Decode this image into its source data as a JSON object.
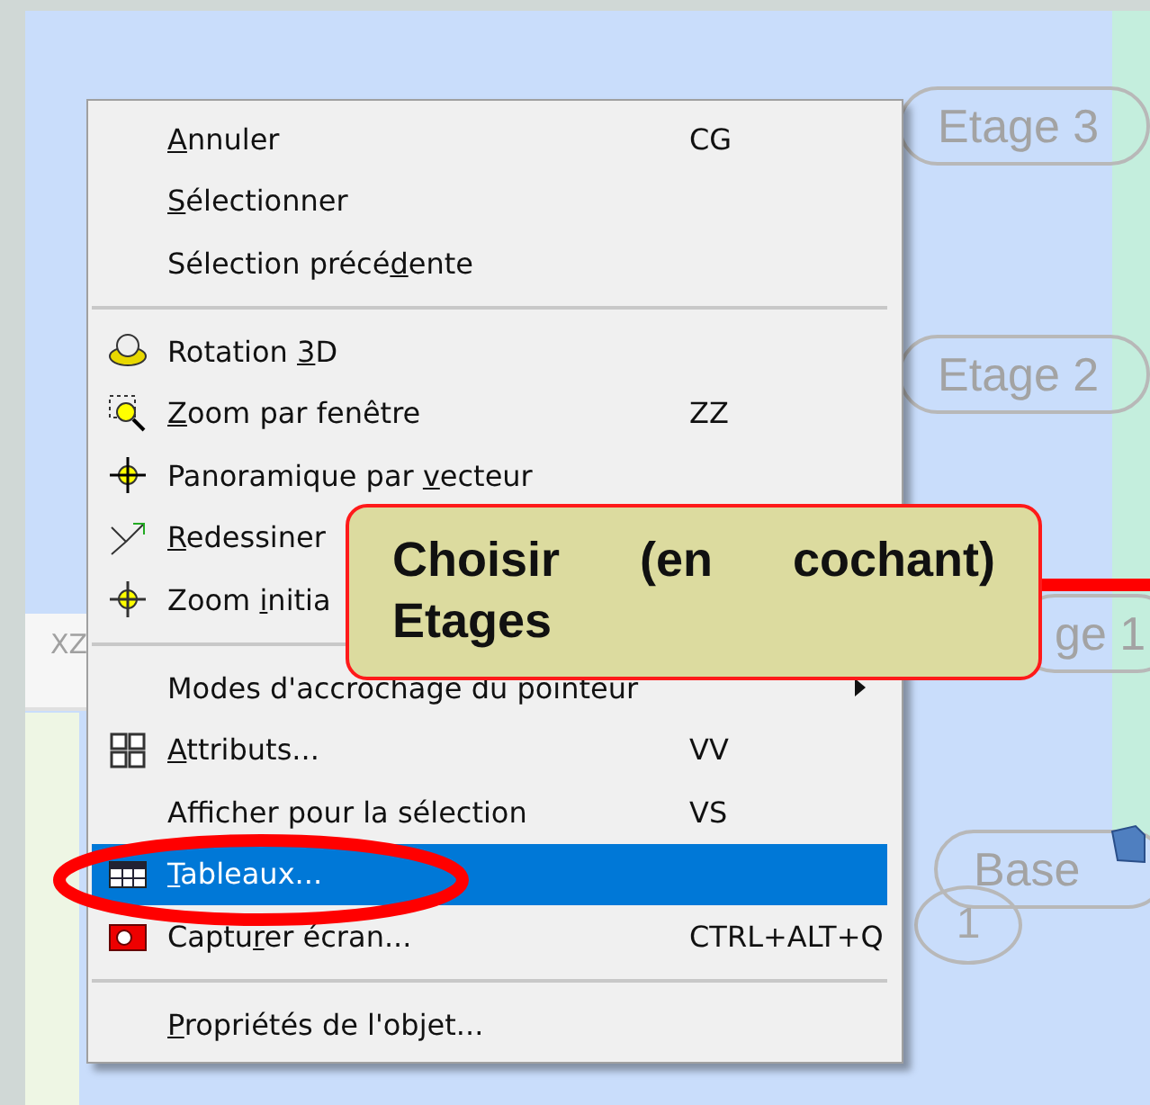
{
  "canvas": {
    "labels": [
      {
        "text": "Etage 3",
        "kind": "floor"
      },
      {
        "text": "Etage 2",
        "kind": "floor"
      },
      {
        "text": "ge 1",
        "kind": "floor"
      },
      {
        "text": "Base",
        "kind": "base"
      },
      {
        "text": "1",
        "kind": "marker"
      }
    ],
    "toolbar_text": "XZ"
  },
  "context_menu": {
    "items": [
      {
        "kind": "item",
        "label": [
          {
            "text": "A",
            "underlined": true
          },
          {
            "text": "nnuler",
            "underlined": false
          }
        ],
        "shortcut": "CG",
        "selected": false
      },
      {
        "kind": "item",
        "label": [
          {
            "text": "S",
            "underlined": true
          },
          {
            "text": "électionner",
            "underlined": false
          }
        ],
        "selected": false
      },
      {
        "kind": "item",
        "label": [
          {
            "text": "Sélection précé",
            "underlined": false
          },
          {
            "text": "d",
            "underlined": true
          },
          {
            "text": "ente",
            "underlined": false
          }
        ],
        "selected": false
      },
      {
        "kind": "separator"
      },
      {
        "kind": "item",
        "label": [
          {
            "text": "Rotation ",
            "underlined": false
          },
          {
            "text": "3",
            "underlined": true
          },
          {
            "text": "D",
            "underlined": false
          }
        ],
        "selected": false
      },
      {
        "kind": "item",
        "label": [
          {
            "text": "Z",
            "underlined": true
          },
          {
            "text": "oom par fenêtre",
            "underlined": false
          }
        ],
        "shortcut": "ZZ",
        "selected": false
      },
      {
        "kind": "item",
        "label": [
          {
            "text": "Panoramique par ",
            "underlined": false
          },
          {
            "text": "v",
            "underlined": true
          },
          {
            "text": "ecteur",
            "underlined": false
          }
        ],
        "selected": false
      },
      {
        "kind": "item",
        "label": [
          {
            "text": "R",
            "underlined": true
          },
          {
            "text": "edessiner",
            "underlined": false
          }
        ],
        "selected": false
      },
      {
        "kind": "item",
        "label": [
          {
            "text": "Zoom ",
            "underlined": false
          },
          {
            "text": "i",
            "underlined": true
          },
          {
            "text": "nitia",
            "underlined": false
          }
        ],
        "selected": false
      },
      {
        "kind": "separator"
      },
      {
        "kind": "item",
        "label": [
          {
            "text": "Modes d'accrochage du pointeur",
            "underlined": false
          }
        ],
        "submenu": true,
        "selected": false
      },
      {
        "kind": "item",
        "label": [
          {
            "text": "A",
            "underlined": true
          },
          {
            "text": "ttributs...",
            "underlined": false
          }
        ],
        "shortcut": "VV",
        "selected": false
      },
      {
        "kind": "item",
        "label": [
          {
            "text": "Afficher pour la sélection",
            "underlined": false
          }
        ],
        "shortcut": "VS",
        "selected": false
      },
      {
        "kind": "item",
        "label": [
          {
            "text": "T",
            "underlined": true
          },
          {
            "text": "ableaux...",
            "underlined": false
          }
        ],
        "selected": true
      },
      {
        "kind": "item",
        "label": [
          {
            "text": "Captu",
            "underlined": false
          },
          {
            "text": "r",
            "underlined": true
          },
          {
            "text": "er écran...",
            "underlined": false
          }
        ],
        "shortcut": "CTRL+ALT+Q",
        "selected": false
      },
      {
        "kind": "separator"
      },
      {
        "kind": "item",
        "label": [
          {
            "text": "P",
            "underlined": true
          },
          {
            "text": "ropriétés de l'objet...",
            "underlined": false
          }
        ],
        "selected": false
      }
    ]
  },
  "callout": {
    "text": "Choisir (en cochant) Etages"
  }
}
